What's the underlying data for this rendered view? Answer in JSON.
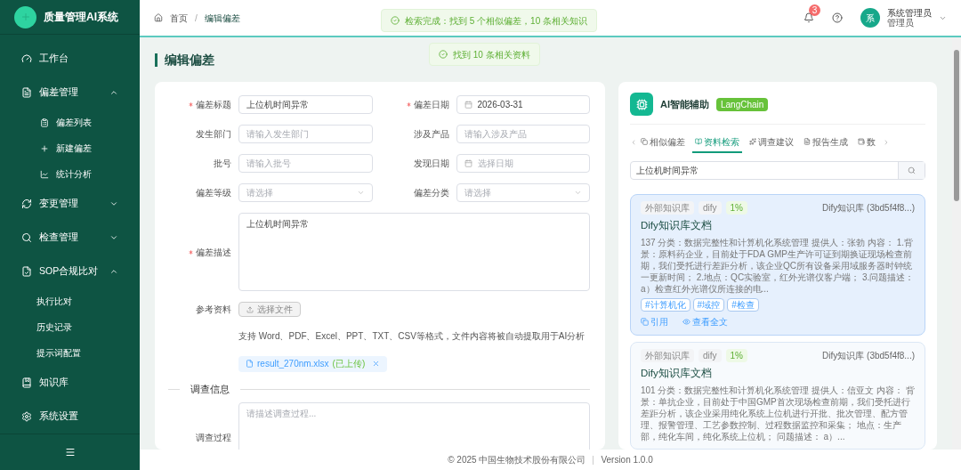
{
  "app": {
    "title": "质量管理AI系统"
  },
  "sidebar": {
    "items": [
      {
        "label": "工作台"
      },
      {
        "label": "偏差管理",
        "expanded": true,
        "children": [
          {
            "label": "偏差列表"
          },
          {
            "label": "新建偏差"
          },
          {
            "label": "统计分析"
          }
        ]
      },
      {
        "label": "变更管理",
        "expanded": false
      },
      {
        "label": "检查管理",
        "expanded": false
      },
      {
        "label": "SOP合规比对",
        "expanded": true,
        "children": [
          {
            "label": "执行比对"
          },
          {
            "label": "历史记录"
          },
          {
            "label": "提示词配置"
          }
        ]
      },
      {
        "label": "知识库"
      },
      {
        "label": "系统设置"
      }
    ]
  },
  "header": {
    "breadcrumb": [
      "首页",
      "编辑偏差"
    ],
    "breadcrumb_separator": "/",
    "notifications": "3",
    "user": {
      "avatar": "系",
      "name": "系统管理员",
      "role": "管理员"
    }
  },
  "toasts": [
    "检索完成：找到 5 个相似偏差，10 条相关知识",
    "找到 10 条相关资料"
  ],
  "page_title": "编辑偏差",
  "form": {
    "fields": [
      {
        "kind": "input",
        "label": "偏差标题",
        "required": true,
        "value": "上位机时间异常"
      },
      {
        "kind": "date",
        "label": "偏差日期",
        "required": true,
        "value": "2026-03-31"
      },
      {
        "kind": "input",
        "label": "发生部门",
        "required": false,
        "placeholder": "请输入发生部门"
      },
      {
        "kind": "input",
        "label": "涉及产品",
        "required": false,
        "placeholder": "请输入涉及产品"
      },
      {
        "kind": "input",
        "label": "批号",
        "required": false,
        "placeholder": "请输入批号"
      },
      {
        "kind": "date",
        "label": "发现日期",
        "required": false,
        "placeholder": "选择日期"
      },
      {
        "kind": "select",
        "label": "偏差等级",
        "required": false,
        "placeholder": "请选择"
      },
      {
        "kind": "select",
        "label": "偏差分类",
        "required": false,
        "placeholder": "请选择"
      }
    ],
    "description": {
      "label": "偏差描述",
      "required": true,
      "value": "上位机时间异常"
    },
    "attachments": {
      "label": "参考资料",
      "button": "选择文件",
      "hint": "支持 Word、PDF、Excel、PPT、TXT、CSV等格式，文件内容将被自动提取用于AI分析",
      "file": {
        "name": "result_270nm.xlsx",
        "status": "(已上传)"
      }
    },
    "section": "调查信息",
    "investigation": {
      "label": "调查过程",
      "placeholder": "请描述调查过程..."
    }
  },
  "ai_panel": {
    "title": "AI智能辅助",
    "badge": "LangChain",
    "tabs": [
      {
        "label": "相似偏差",
        "selected": false
      },
      {
        "label": "资料检索",
        "selected": true
      },
      {
        "label": "调查建议",
        "selected": false
      },
      {
        "label": "报告生成",
        "selected": false
      },
      {
        "label": "数",
        "selected": false
      }
    ],
    "search": {
      "value": "上位机时间异常"
    },
    "results": [
      {
        "selected": true,
        "tags": [
          "外部知识库",
          "dify",
          "1%"
        ],
        "source": "Dify知识库 (3bd5f4f8...)",
        "title": "Dify知识库文档",
        "body": "137 分类：数据完整性和计算机化系统管理 提供人：张勃 内容： 1.背景：原料药企业，目前处于FDA GMP生产许可证到期换证现场检查前期，我们受托进行差距分析，该企业QC所有设备采用域服务器时钟统一更新时间； 2.地点：QC实验室，红外光谱仪客户端； 3.问题描述： a）检查红外光谱仪所连接的电...",
        "keywords": [
          "#计算机化",
          "#域控",
          "#检查"
        ],
        "actions": [
          "引用",
          "查看全文"
        ]
      },
      {
        "selected": false,
        "tags": [
          "外部知识库",
          "dify",
          "1%"
        ],
        "source": "Dify知识库 (3bd5f4f8...)",
        "title": "Dify知识库文档",
        "body": "101 分类：数据完整性和计算机化系统管理 提供人：信亚文 内容： 背景：单抗企业，目前处于中国GMP首次现场检查前期，我们受托进行差距分析，该企业采用纯化系统上位机进行开批、批次管理、配方管理、报警管理、工艺参数控制、过程数据监控和采集； 地点：生产部，纯化车间，纯化系统上位机； 问题描述： a）..."
      }
    ]
  },
  "footer": {
    "copyright": "© 2025 中国生物技术股份有限公司",
    "version": "Version 1.0.0"
  }
}
